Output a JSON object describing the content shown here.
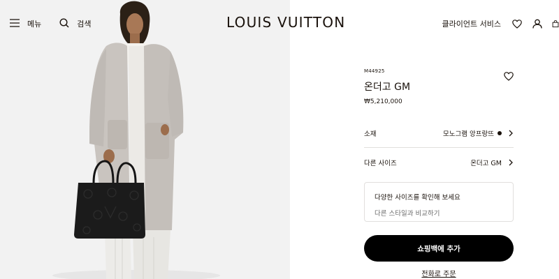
{
  "header": {
    "menu_label": "메뉴",
    "search_label": "검색",
    "logo_text": "LOUIS VUITTON",
    "client_services_label": "클라이언트 서비스",
    "icons": [
      "menu-icon",
      "search-icon",
      "heart-icon",
      "user-icon",
      "bag-icon"
    ]
  },
  "photo": {
    "alt_subject": "model-wearing-grey-coat-holding-black-tote"
  },
  "product": {
    "sku": "M44925",
    "name": "온더고 GM",
    "price": "₩5,210,000",
    "material_label": "소재",
    "material_value": "모노그램 앙프랑뜨",
    "material_swatch_color": "#19110b",
    "other_size_label": "다른 사이즈",
    "other_size_value": "온더고 GM",
    "size_box_title": "다양한 사이즈를 확인해 보세요",
    "size_box_subtitle": "다른 스타일과 비교하기",
    "add_to_bag_label": "쇼핑백에 추가",
    "phone_order_label": "전화로 주문"
  },
  "colors": {
    "text": "#19110b",
    "button_bg": "#000000",
    "divider": "#e1dfdd",
    "photo_bg": "#f2f2f2"
  }
}
